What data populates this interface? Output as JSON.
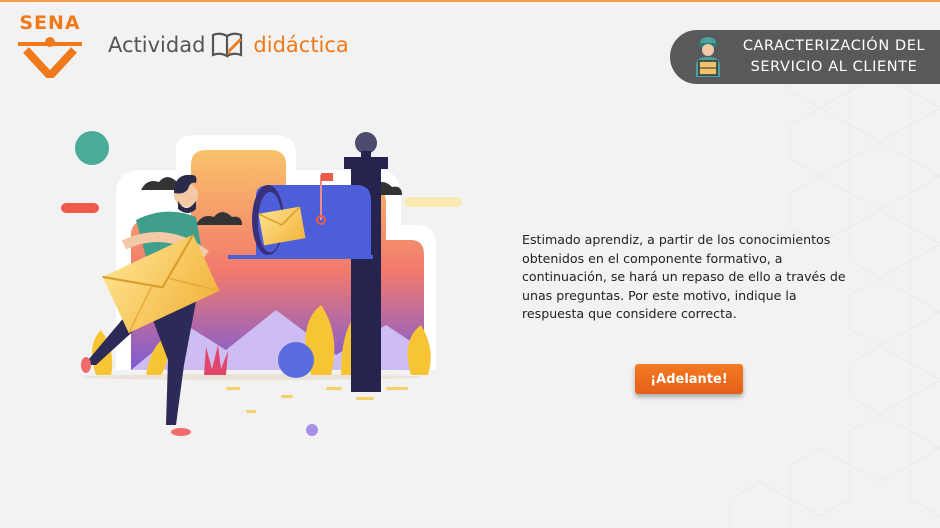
{
  "header": {
    "logo_text": "SENA",
    "activity_word1": "Actividad",
    "activity_word2": "didáctica"
  },
  "course_badge": {
    "line1": "CARACTERIZACIÓN DEL",
    "line2": "SERVICIO AL CLIENTE"
  },
  "main": {
    "instructions": "Estimado aprendiz, a partir de los conocimientos obtenidos en el componente formativo, a continuación, se hará un repaso de ello a través de unas preguntas. Por este motivo, indique la respuesta que considere correcta.",
    "next_button": "¡Adelante!"
  },
  "colors": {
    "accent": "#f07a1a",
    "badge_bg": "#58595b",
    "button": "#f47a22",
    "background": "#f2f2f2"
  },
  "icons": [
    "sena-logo",
    "book-pencil-icon",
    "delivery-person-icon",
    "mailbox-illustration"
  ]
}
